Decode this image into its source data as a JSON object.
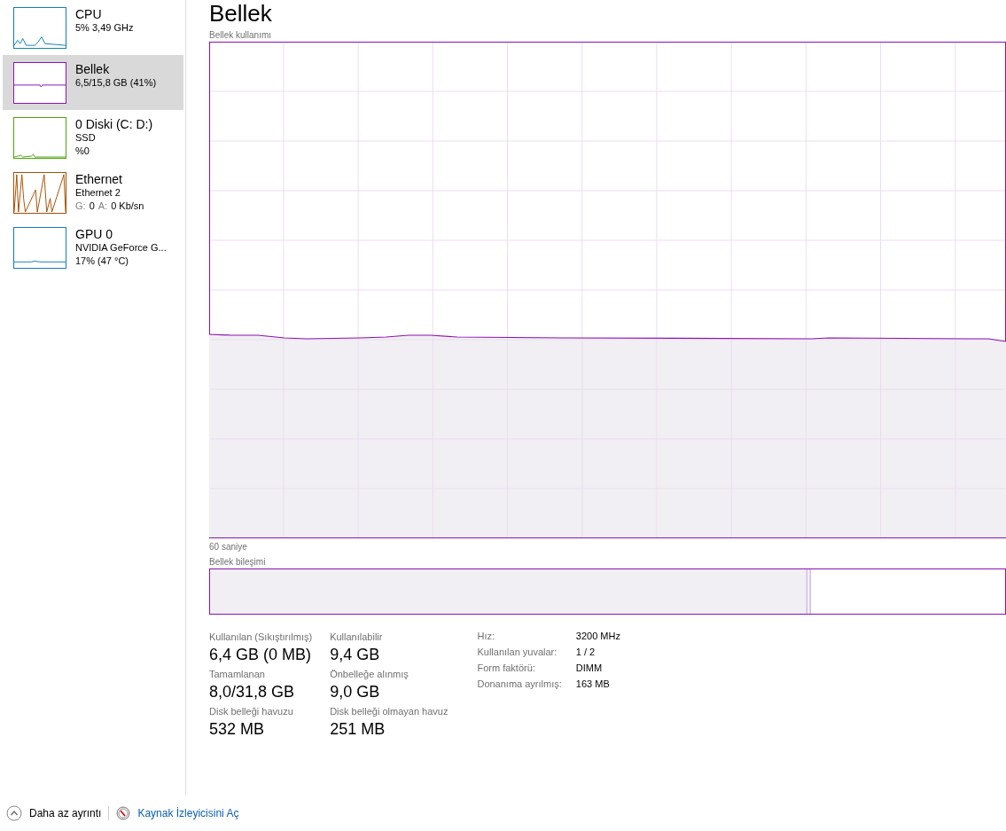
{
  "sidebar": {
    "items": [
      {
        "title": "CPU",
        "lines": [
          "5% 3,49 GHz"
        ],
        "color": "#117dbb",
        "selected": false
      },
      {
        "title": "Bellek",
        "lines": [
          "6,5/15,8 GB (41%)"
        ],
        "color": "#8b12ae",
        "selected": true
      },
      {
        "title": "0 Diski (C: D:)",
        "lines": [
          "SSD",
          "%0"
        ],
        "color": "#4da60c",
        "selected": false
      },
      {
        "title": "Ethernet",
        "lines": [
          "Ethernet 2"
        ],
        "rate_parts": [
          {
            "text": "G:",
            "muted": true
          },
          {
            "text": "0",
            "muted": false
          },
          {
            "text": "A:",
            "muted": true
          },
          {
            "text": "0 Kb/sn",
            "muted": false
          }
        ],
        "color": "#a74f01",
        "selected": false
      },
      {
        "title": "GPU 0",
        "lines": [
          "NVIDIA GeForce G...",
          "17% (47 °C)"
        ],
        "color": "#117dbb",
        "selected": false
      }
    ]
  },
  "main": {
    "title": "Bellek",
    "usage_label": "Bellek kullanımı",
    "time_label": "60 saniye",
    "composition_label": "Bellek bileşimi",
    "stats": [
      {
        "label": "Kullanılan (Sıkıştırılmış)",
        "value": "6,4 GB (0 MB)"
      },
      {
        "label": "Kullanılabilir",
        "value": "9,4 GB"
      },
      {
        "label": "Tamamlanan",
        "value": "8,0/31,8 GB"
      },
      {
        "label": "Önbelleğe alınmış",
        "value": "9,0 GB"
      },
      {
        "label": "Disk belleği havuzu",
        "value": "532 MB"
      },
      {
        "label": "Disk belleği olmayan havuz",
        "value": "251 MB"
      }
    ],
    "details": [
      {
        "key": "Hız:",
        "value": "3200 MHz"
      },
      {
        "key": "Kullanılan yuvalar:",
        "value": "1 / 2"
      },
      {
        "key": "Form faktörü:",
        "value": "DIMM"
      },
      {
        "key": "Donanıma ayrılmış:",
        "value": "163 MB"
      }
    ]
  },
  "footer": {
    "less_details": "Daha az ayrıntı",
    "resource_monitor_link": "Kaynak İzleyicisini Aç"
  }
}
